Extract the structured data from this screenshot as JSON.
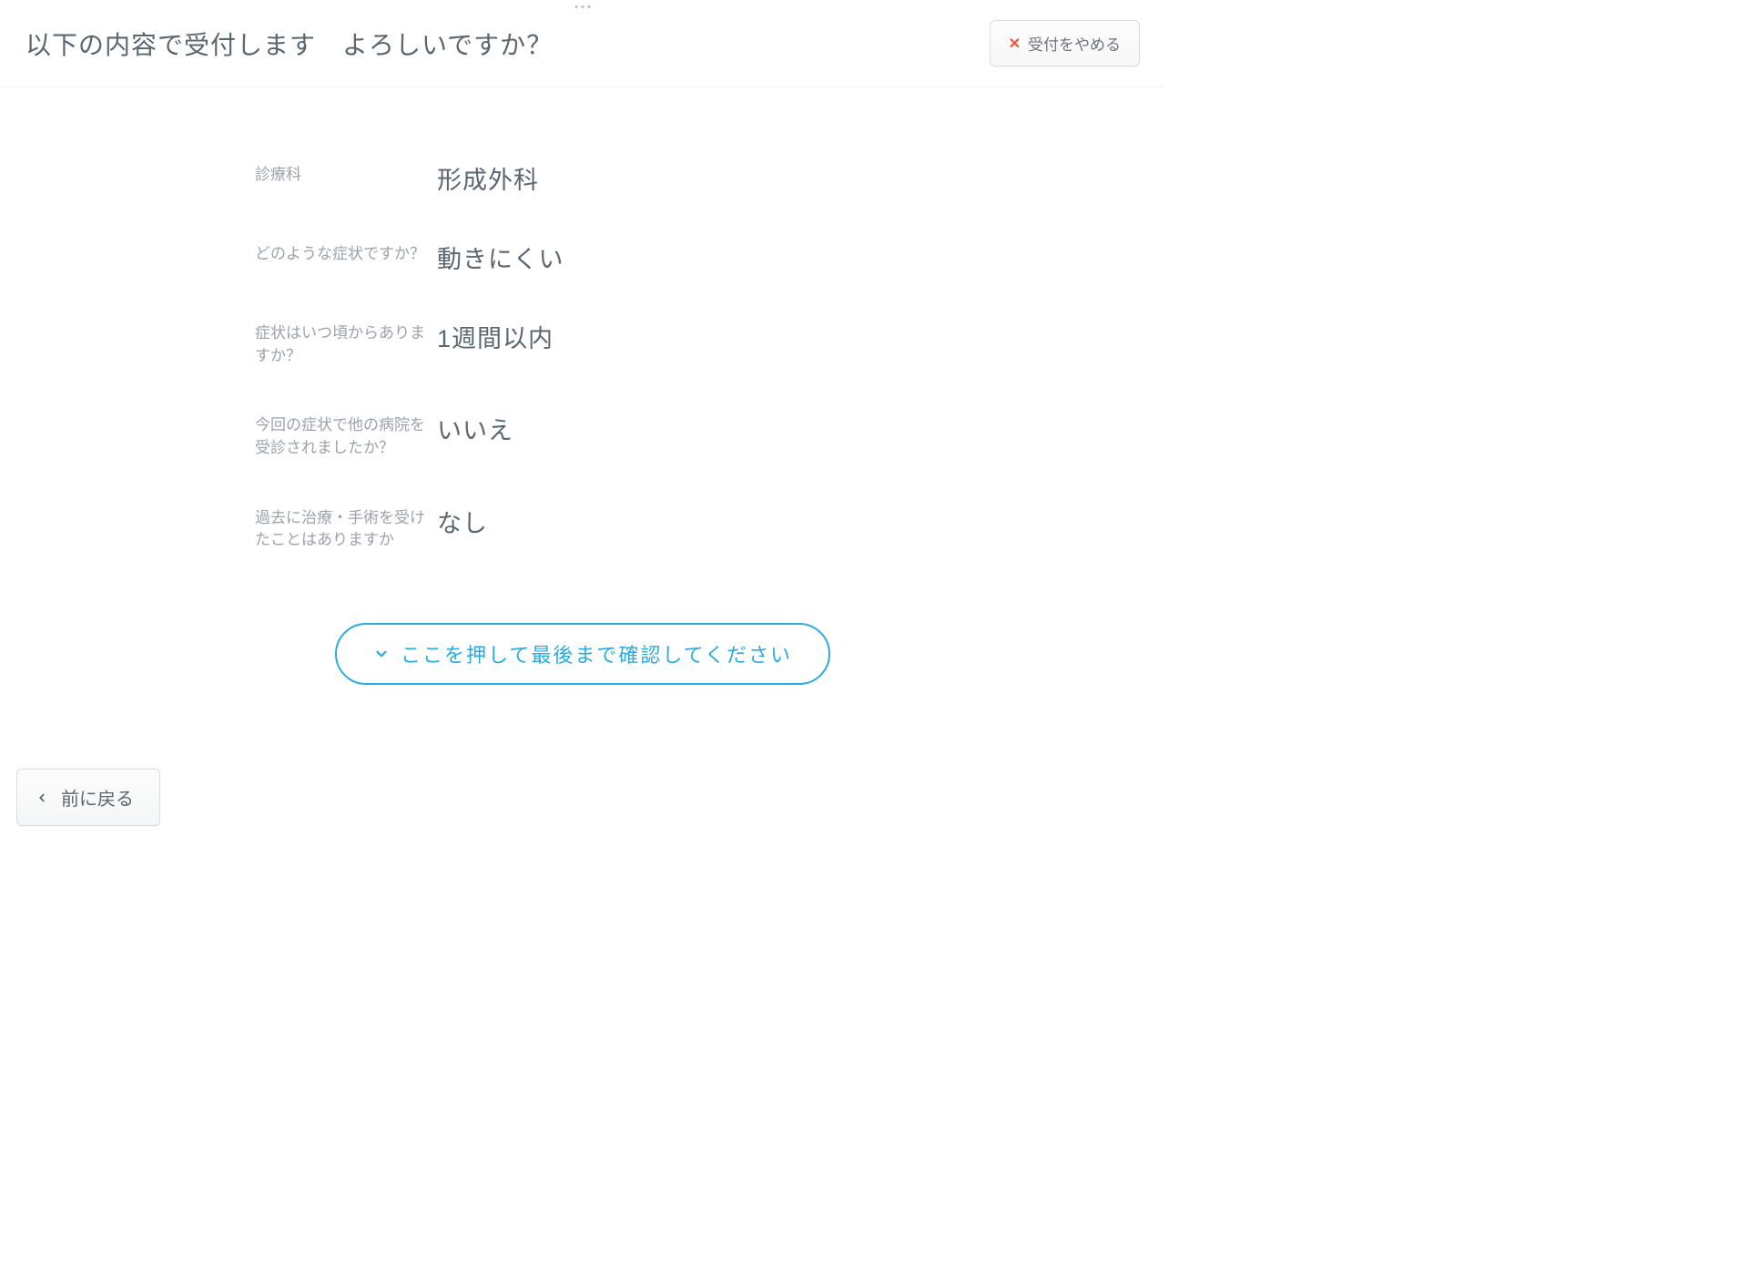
{
  "header": {
    "title": "以下の内容で受付します　よろしいですか？",
    "cancel_label": "受付をやめる"
  },
  "info": [
    {
      "label": "診療科",
      "value": "形成外科"
    },
    {
      "label": "どのような症状ですか？",
      "value": "動きにくい"
    },
    {
      "label": "症状はいつ頃からありますか？",
      "value": "1週間以内"
    },
    {
      "label": "今回の症状で他の病院を受診されましたか？",
      "value": "いいえ"
    },
    {
      "label": "過去に治療・手術を受けたことはありますか",
      "value": "なし"
    }
  ],
  "scroll_confirm_label": "ここを押して最後まで確認してください",
  "back_label": "前に戻る",
  "colors": {
    "accent": "#29abe2",
    "text_primary": "#5a6770",
    "text_muted": "#9aa3ab",
    "danger": "#e55a3a"
  }
}
